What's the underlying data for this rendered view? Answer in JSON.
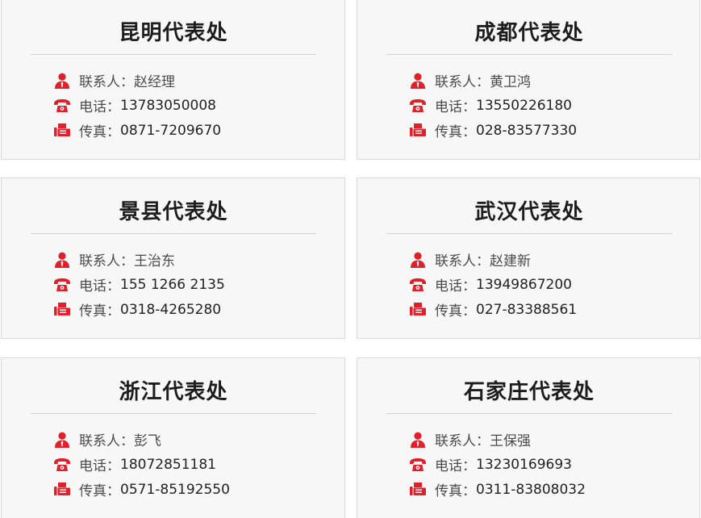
{
  "colors": {
    "icon_red": "#e0202a",
    "card_bg": "#f7f7f7",
    "border": "#d9d9d9"
  },
  "icons": {
    "contact": "person-icon",
    "phone": "phone-icon",
    "fax": "fax-icon"
  },
  "offices": [
    {
      "title": "昆明代表处",
      "contact_label": "联系人：",
      "contact": "赵经理",
      "phone_label": "电话：",
      "phone": "13783050008",
      "fax_label": "传真：",
      "fax": "0871-7209670"
    },
    {
      "title": "成都代表处",
      "contact_label": "联系人：",
      "contact": "黄卫鸿",
      "phone_label": "电话：",
      "phone": "13550226180",
      "fax_label": "传真：",
      "fax": "028-83577330"
    },
    {
      "title": "景县代表处",
      "contact_label": "联系人：",
      "contact": "王治东",
      "phone_label": "电话：",
      "phone": "155 1266 2135",
      "fax_label": "传真：",
      "fax": "0318-4265280"
    },
    {
      "title": "武汉代表处",
      "contact_label": "联系人：",
      "contact": "赵建新",
      "phone_label": "电话：",
      "phone": "13949867200",
      "fax_label": "传真：",
      "fax": "027-83388561"
    },
    {
      "title": "浙江代表处",
      "contact_label": "联系人：",
      "contact": "彭飞",
      "phone_label": "电话：",
      "phone": "18072851181",
      "fax_label": "传真：",
      "fax": "0571-85192550"
    },
    {
      "title": "石家庄代表处",
      "contact_label": "联系人：",
      "contact": "王保强",
      "phone_label": "电话：",
      "phone": "13230169693",
      "fax_label": "传真：",
      "fax": "0311-83808032"
    }
  ]
}
